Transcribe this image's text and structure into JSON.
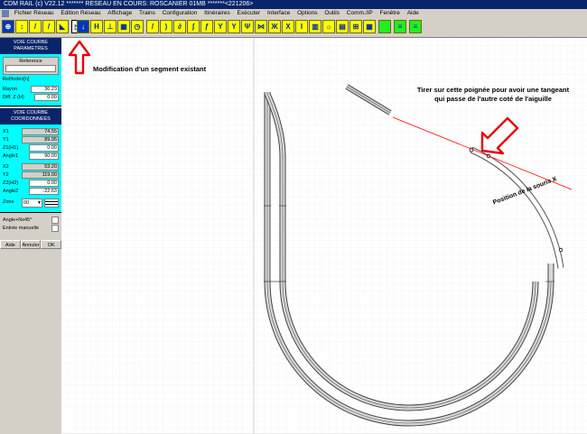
{
  "window": {
    "title": "CDM RAIL (c) V22.12      ******* RESEAU EN COURS: ROSCANIER 01MB *******<221206>"
  },
  "menu": [
    "Fichier Réseau",
    "Edition Réseau",
    "Affichage",
    "Trains",
    "Configuration",
    "Itinéraires",
    "Exécuter",
    "Interface",
    "Options",
    "Outils",
    "Comm./IP",
    "Fenêtre",
    "Aide"
  ],
  "toolbar": {
    "buttons": [
      {
        "name": "select-pointer-icon",
        "glyph": "↖"
      },
      {
        "name": "track-straight-icon",
        "glyph": "/"
      },
      {
        "name": "track-turnout-icon",
        "glyph": "/"
      },
      {
        "name": "track-curve-icon",
        "glyph": "◣"
      },
      {
        "name": "modify-segment-icon",
        "glyph": "↕"
      },
      {
        "name": "height-icon",
        "glyph": "H"
      }
    ]
  },
  "panel": {
    "section1_title": "VOIE COURBE PARAMETRES",
    "reference_label": "Reference",
    "reference_value": "Ref/index[n]",
    "rayon_label": "Rayon",
    "rayon_value": "30.23",
    "diff_label": "Diff. Z (H)",
    "diff_value": "0.00",
    "section2_title": "VOIE COURBE COORDONNEES",
    "x1_label": "X1",
    "x1_value": "74.55",
    "y1_label": "Y1",
    "y1_value": "89.95",
    "z1_label": "Z1(H1)",
    "z1_value": "0.00",
    "angle1_label": "Angle1",
    "angle1_value": "90.00",
    "x2_label": "X2",
    "x2_value": "53.20",
    "y2_label": "Y2",
    "y2_value": "119.00",
    "z2_label": "Z2(H2)",
    "z2_value": "0.00",
    "angle2_label": "Angle2",
    "angle2_value": "-22.63",
    "zone_label": "Zone",
    "zone_value": "00",
    "angle_nx_label": "Angle+Nx45°",
    "entree_label": "Entrée manuelle",
    "btn_aide": "Aide",
    "btn_annuler": "Annuler",
    "btn_ok": "OK"
  },
  "annotations": {
    "modif": "Modification d'un segment existant",
    "tirer_line1": "Tirer sur cette poignée pour avoir une tangeant",
    "tirer_line2": "qui passe de l'autre coté de l'aiguille",
    "position": "Position de la souris X"
  },
  "colors": {
    "title_bg": "#08246b",
    "panel_header": "#0a246a",
    "panel_cyan": "#00ffff",
    "toolbar_yellow": "#ffff00",
    "arrow_red": "#e8000c",
    "tangent_red": "#ff0000"
  }
}
